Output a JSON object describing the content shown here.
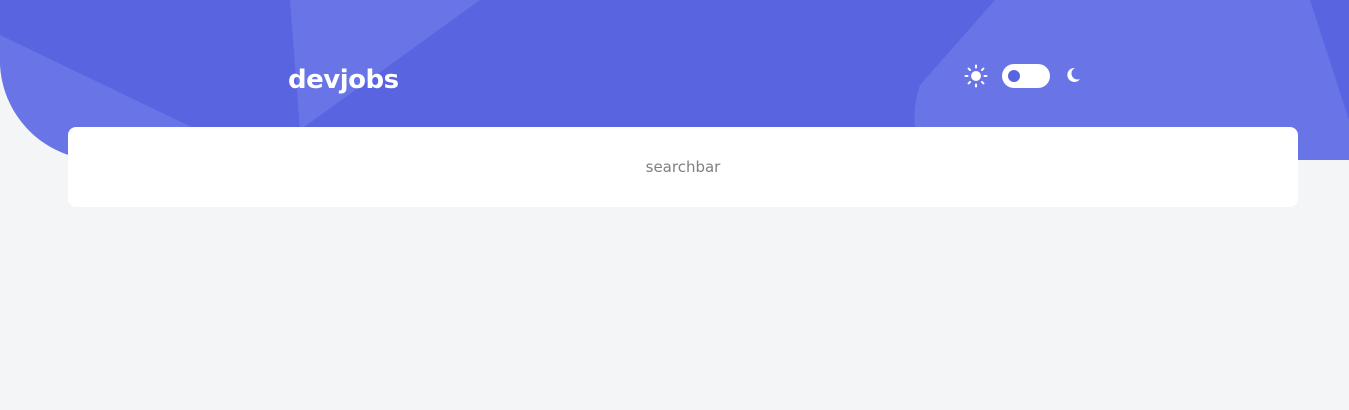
{
  "header": {
    "logo_text": "devjobs",
    "background_color": "#5964e0",
    "shape_color": "#6974e6"
  },
  "theme_toggle": {
    "light_icon": "sun-icon",
    "dark_icon": "moon-icon",
    "mode": "light",
    "knob_color": "#5964e0"
  },
  "search": {
    "label": "searchbar"
  },
  "page": {
    "background_color": "#f4f5f7"
  }
}
